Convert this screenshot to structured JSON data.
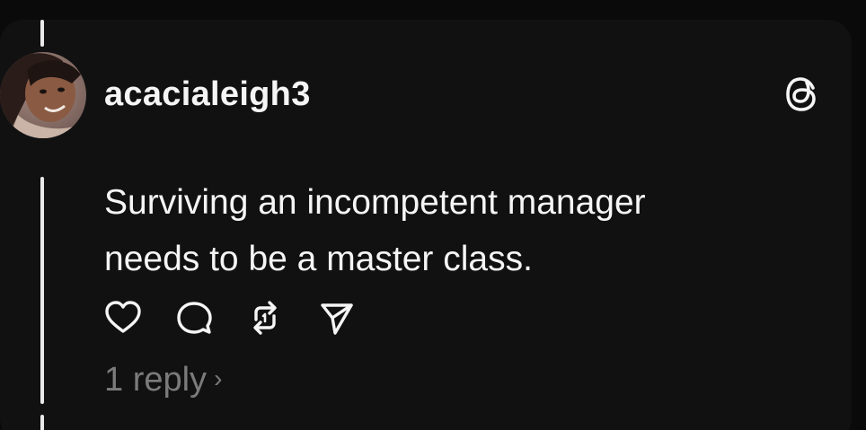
{
  "post": {
    "username": "acacialeigh3",
    "text_lines": [
      "Surviving an incompetent manager",
      "needs to be a master class."
    ],
    "reply_count_label": "1 reply",
    "reply_chevron": "›"
  },
  "icons": {
    "brand": "threads-logo-icon",
    "like": "heart-icon",
    "reply": "comment-bubble-icon",
    "repost": "repost-arrows-icon",
    "share": "send-paper-plane-icon"
  },
  "colors": {
    "background": "#0a0a0a",
    "card": "#111112",
    "text_primary": "#f5f5f5",
    "text_secondary": "#7b7b7b",
    "thread_line": "#e9e9e9"
  }
}
